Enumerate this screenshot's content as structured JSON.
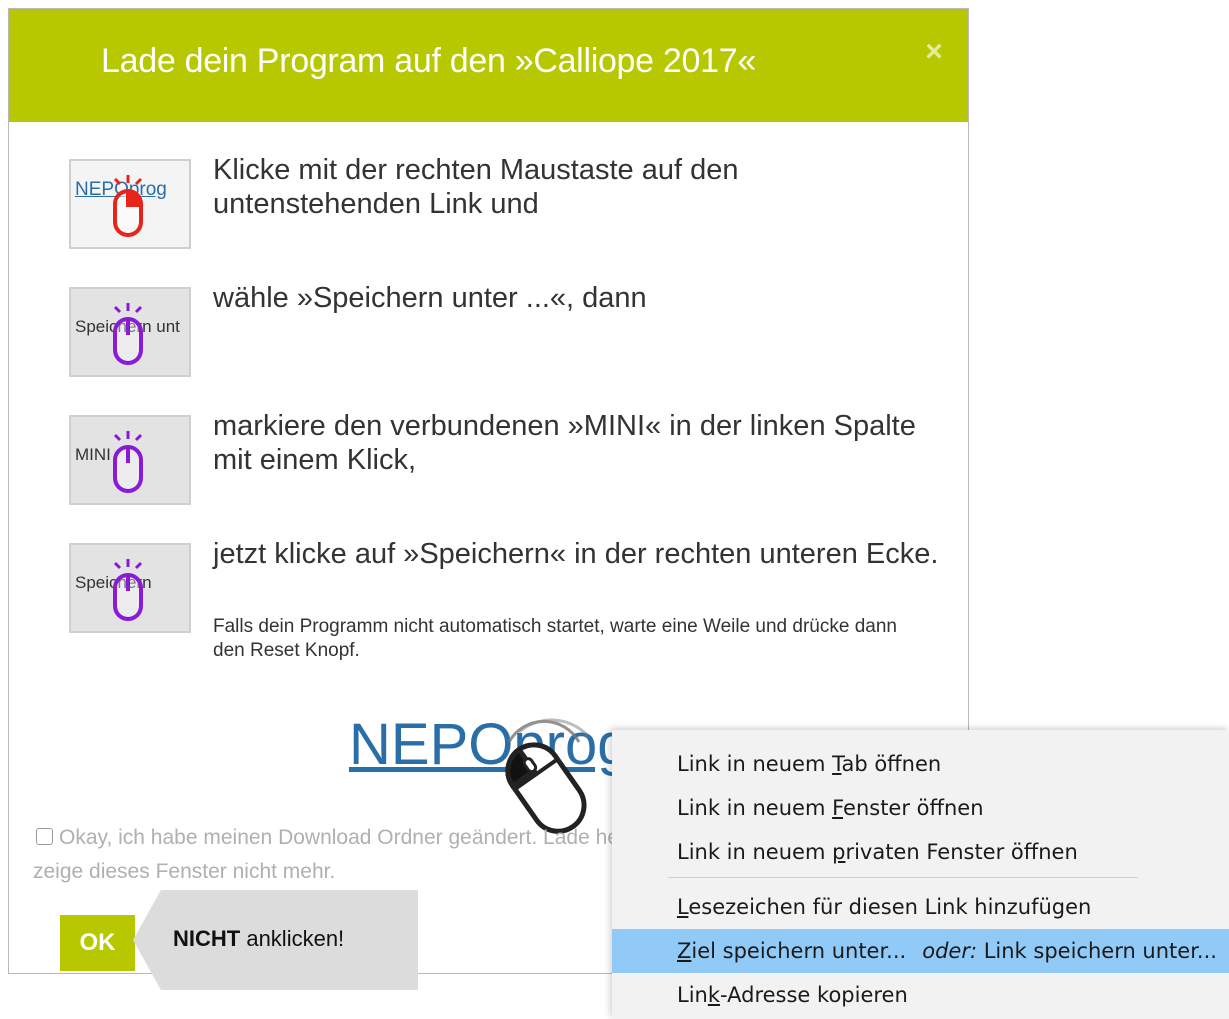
{
  "dialog": {
    "title": "Lade dein Program auf den »Calliope 2017«",
    "close_icon": "×",
    "steps": [
      {
        "thumb_text": "NEPOprog",
        "text": "Klicke mit der rechten Maustaste auf den untenstehenden Link und",
        "mouse_color": "#e8231c"
      },
      {
        "thumb_text": "Speichern unt",
        "text": "wähle »Speichern unter ...«, dann",
        "mouse_color": "#8a1ad8"
      },
      {
        "thumb_text": "MINI",
        "text": "markiere den verbundenen »MINI« in der linken Spalte mit einem Klick,",
        "mouse_color": "#8a1ad8"
      },
      {
        "thumb_text": "Speichern",
        "text": "jetzt klicke auf »Speichern« in der rechten unteren Ecke.",
        "note": "Falls dein Programm nicht automatisch startet, warte eine Weile und drücke dann den Reset Knopf.",
        "mouse_color": "#8a1ad8"
      }
    ],
    "download_link": "NEPOprog",
    "checkbox_label": "Okay, ich habe meinen Download Ordner geändert. Lade herunter und zeige dieses Fenster nicht mehr.",
    "ok_label": "OK",
    "accent_color": "#b7c800"
  },
  "callout": {
    "bold": "NICHT",
    "rest": " anklicken!"
  },
  "context_menu": {
    "items": [
      {
        "pre": "Link in neuem ",
        "u": "T",
        "post": "ab öffnen"
      },
      {
        "pre": "Link in neuem ",
        "u": "F",
        "post": "enster öffnen"
      },
      {
        "pre": "Link in neuem ",
        "u": "p",
        "post": "rivaten Fenster öffnen"
      },
      {
        "pre": "",
        "u": "L",
        "post": "esezeichen für diesen Link hinzufügen"
      },
      {
        "pre": "",
        "u": "Z",
        "post": "iel speichern unter...",
        "alt_italic": "oder:",
        "alt": " Link speichern unter..."
      },
      {
        "pre": "Lin",
        "u": "k",
        "post": "-Adresse kopieren"
      }
    ],
    "highlight_color": "#91c9f7"
  }
}
